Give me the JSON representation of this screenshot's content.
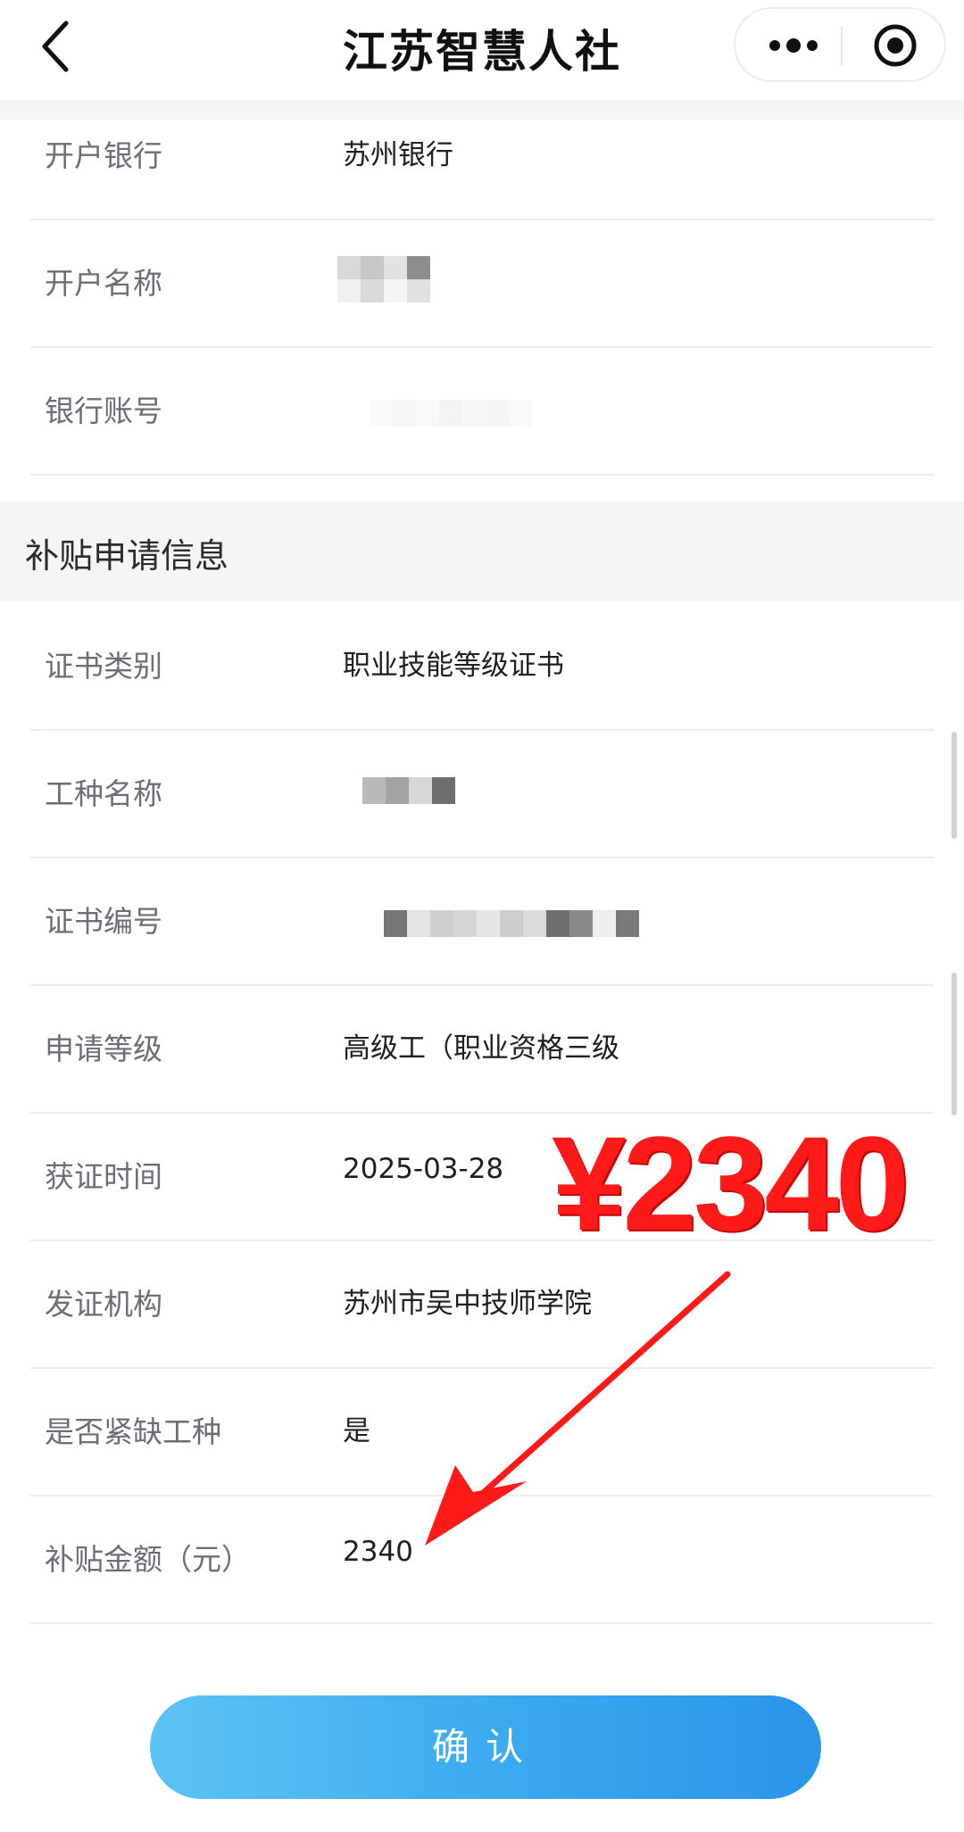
{
  "nav": {
    "title": "江苏智慧人社"
  },
  "account_section": {
    "rows": [
      {
        "label": "开户银行",
        "value": "苏州银行"
      },
      {
        "label": "开户名称",
        "value": ""
      },
      {
        "label": "银行账号",
        "value": ""
      }
    ]
  },
  "subsidy_section": {
    "title": "补贴申请信息",
    "rows": [
      {
        "label": "证书类别",
        "value": "职业技能等级证书"
      },
      {
        "label": "工种名称",
        "value": ""
      },
      {
        "label": "证书编号",
        "value": ""
      },
      {
        "label": "申请等级",
        "value": "高级工（职业资格三级"
      },
      {
        "label": "获证时间",
        "value": "2025-03-28"
      },
      {
        "label": "发证机构",
        "value": "苏州市吴中技师学院"
      },
      {
        "label": "是否紧缺工种",
        "value": "是"
      },
      {
        "label": "补贴金额（元）",
        "value": "2340"
      }
    ]
  },
  "annotation": {
    "amount_text": "¥2340",
    "color": "#ff1a1a"
  },
  "confirm_button": {
    "label": "确认"
  },
  "colors": {
    "accent": "#3aa9ef",
    "section_bg": "#f4f5f7",
    "label": "#6b6f75"
  }
}
